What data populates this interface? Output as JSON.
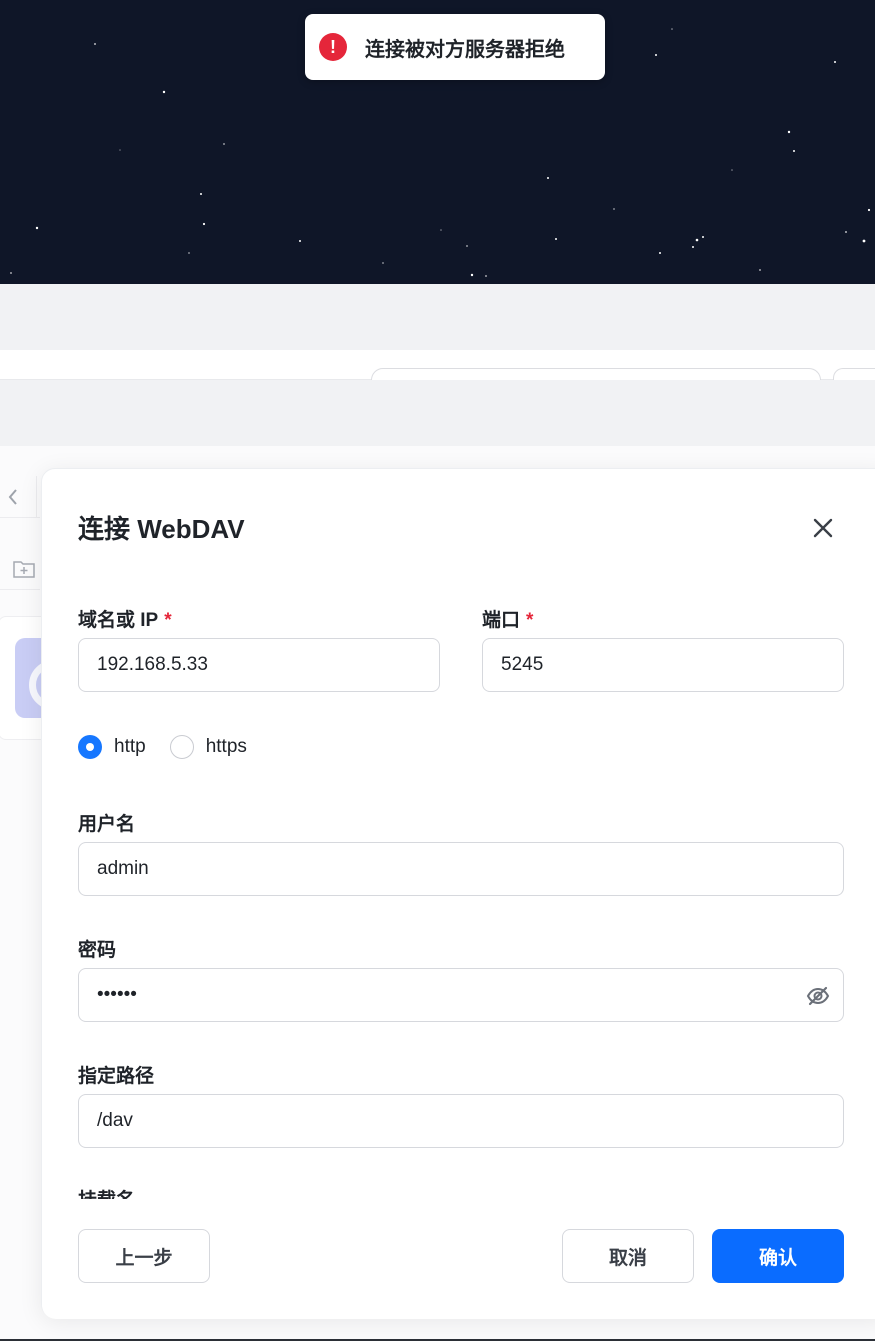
{
  "toast": {
    "message": "连接被对方服务器拒绝",
    "icon": "error-icon",
    "color": "#e5263a"
  },
  "dialog": {
    "title": "连接 WebDAV",
    "close_icon": "close-icon",
    "host": {
      "label": "域名或 IP",
      "required_mark": "*",
      "value": "192.168.5.33"
    },
    "port": {
      "label": "端口",
      "required_mark": "*",
      "value": "5245"
    },
    "protocol": {
      "options": [
        "http",
        "https"
      ],
      "selected": "http"
    },
    "username": {
      "label": "用户名",
      "value": "admin"
    },
    "password": {
      "label": "密码",
      "value": "••••••",
      "toggle_icon": "eye-off-icon"
    },
    "path": {
      "label": "指定路径",
      "value": "/dav"
    },
    "mount_name": {
      "label": "挂载名"
    },
    "buttons": {
      "prev": "上一步",
      "cancel": "取消",
      "confirm": "确认"
    }
  },
  "colors": {
    "primary": "#0a6cff",
    "danger": "#e5263a",
    "sky": "#0f1628"
  }
}
